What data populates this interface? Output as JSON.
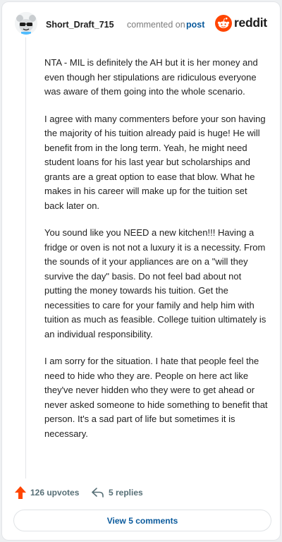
{
  "comment": {
    "username": "Short_Draft_715",
    "action_text": "commented on",
    "post_link": "post",
    "logo_text": "reddit",
    "avatar_icon": "snoo-avatar-icon",
    "paragraphs": [
      "NTA - MIL is definitely the AH but it is her money and even though her stipulations are ridiculous everyone was aware of them going into the whole scenario.",
      "I agree with many commenters before your son having the majority of his tuition already paid is huge! He will benefit from in the long term. Yeah, he might need student loans for his last year but scholarships and grants are a great option to ease that blow. What he makes in his career will make up for the tuition set back later on.",
      "You sound like you NEED a new kitchen!!! Having a fridge or oven is not not a luxury it is a necessity. From the sounds of it your appliances are on a \"will they survive the day\" basis. Do not feel bad about not putting the money towards his tuition. Get the necessities to care for your family and help him with tuition as much as feasible. College tuition ultimately is an individual responsibility.",
      "I am sorry for the situation. I hate that people feel the need to hide who they are. People on here act like they've never hidden who they were to get ahead or never asked someone to hide something to benefit that person. It's a sad part of life but sometimes it is necessary."
    ]
  },
  "actions": {
    "upvotes": "126 upvotes",
    "replies": "5 replies",
    "upvote_icon": "upvote-arrow-icon",
    "reply_icon": "reply-arrow-icon"
  },
  "view_comments_label": "View 5 comments",
  "colors": {
    "brand": "#ff4500",
    "link": "#0a5a9c",
    "meta": "#576f76"
  }
}
